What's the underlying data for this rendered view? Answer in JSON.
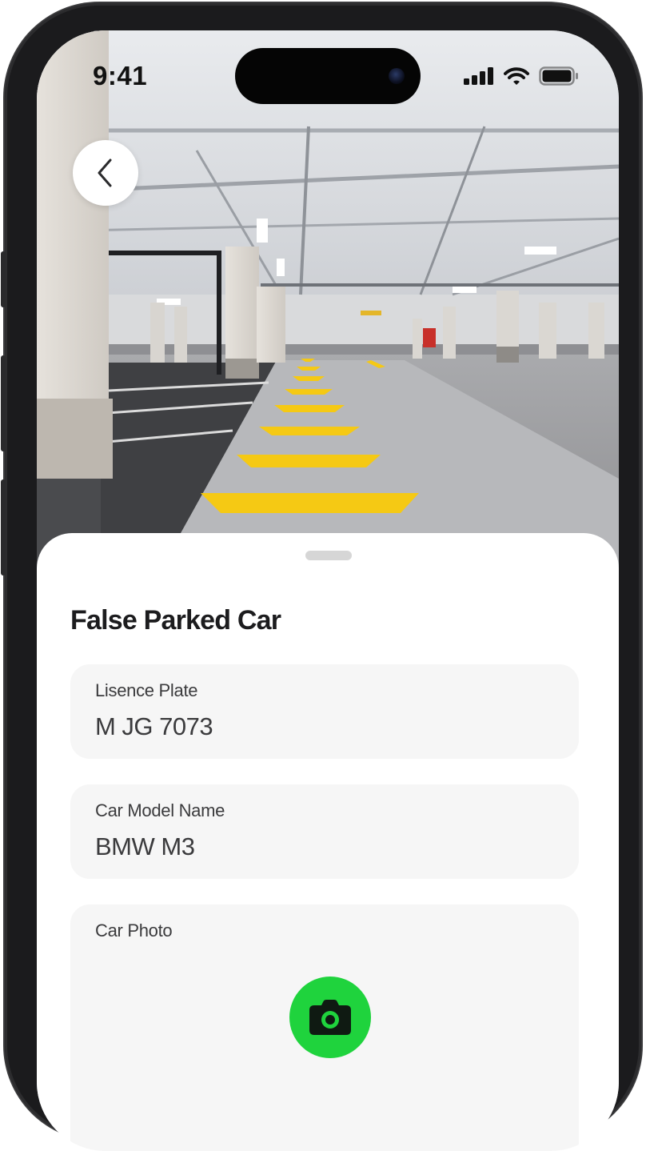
{
  "status_bar": {
    "time": "9:41"
  },
  "sheet": {
    "title": "False Parked Car",
    "fields": [
      {
        "label": "Lisence Plate",
        "value": "M JG 7073"
      },
      {
        "label": "Car Model Name",
        "value": "BMW M3"
      },
      {
        "label": "Car Photo"
      }
    ]
  },
  "icons": {
    "back": "chevron-left-icon",
    "camera": "camera-icon",
    "signal": "cellular-signal-icon",
    "wifi": "wifi-icon",
    "battery": "battery-icon"
  },
  "colors": {
    "accent": "#1fd33d",
    "field_background": "#f6f6f6",
    "floor_marking": "#f5c914"
  }
}
